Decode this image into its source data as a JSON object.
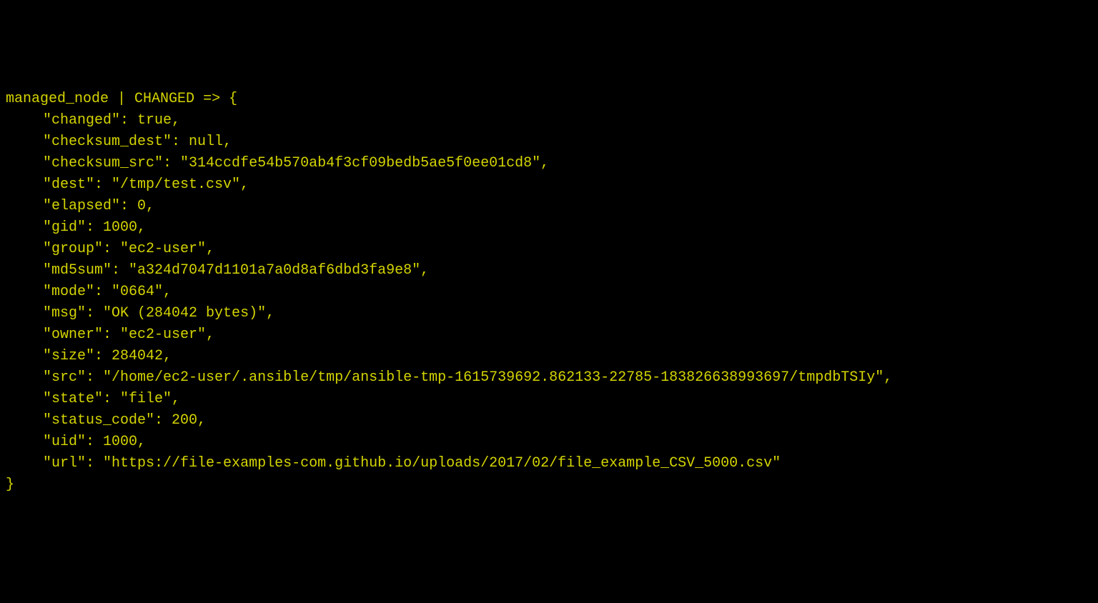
{
  "header": {
    "host": "managed_node",
    "separator": " | ",
    "status": "CHANGED",
    "arrow": " => {"
  },
  "fields": {
    "changed": {
      "key": "\"changed\"",
      "value": "true"
    },
    "checksum_dest": {
      "key": "\"checksum_dest\"",
      "value": "null"
    },
    "checksum_src": {
      "key": "\"checksum_src\"",
      "value": "\"314ccdfe54b570ab4f3cf09bedb5ae5f0ee01cd8\""
    },
    "dest": {
      "key": "\"dest\"",
      "value": "\"/tmp/test.csv\""
    },
    "elapsed": {
      "key": "\"elapsed\"",
      "value": "0"
    },
    "gid": {
      "key": "\"gid\"",
      "value": "1000"
    },
    "group": {
      "key": "\"group\"",
      "value": "\"ec2-user\""
    },
    "md5sum": {
      "key": "\"md5sum\"",
      "value": "\"a324d7047d1101a7a0d8af6dbd3fa9e8\""
    },
    "mode": {
      "key": "\"mode\"",
      "value": "\"0664\""
    },
    "msg": {
      "key": "\"msg\"",
      "value": "\"OK (284042 bytes)\""
    },
    "owner": {
      "key": "\"owner\"",
      "value": "\"ec2-user\""
    },
    "size": {
      "key": "\"size\"",
      "value": "284042"
    },
    "src": {
      "key": "\"src\"",
      "value": "\"/home/ec2-user/.ansible/tmp/ansible-tmp-1615739692.862133-22785-183826638993697/tmpdbTSIy\""
    },
    "state": {
      "key": "\"state\"",
      "value": "\"file\""
    },
    "status_code": {
      "key": "\"status_code\"",
      "value": "200"
    },
    "uid": {
      "key": "\"uid\"",
      "value": "1000"
    },
    "url": {
      "key": "\"url\"",
      "value": "\"https://file-examples-com.github.io/uploads/2017/02/file_example_CSV_5000.csv\""
    }
  },
  "closing_brace": "}"
}
